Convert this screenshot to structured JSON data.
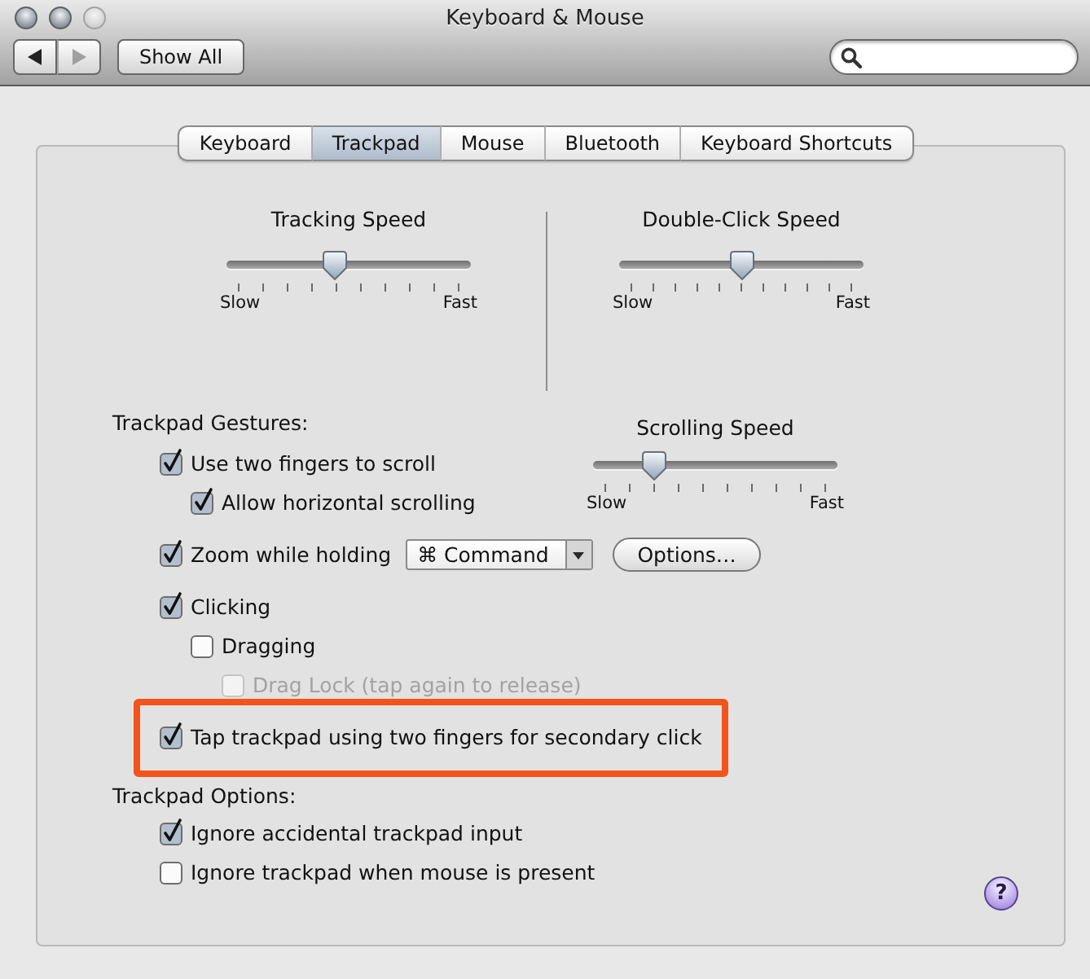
{
  "window": {
    "title": "Keyboard & Mouse",
    "buttons": [
      {
        "disabled": false
      },
      {
        "disabled": false
      },
      {
        "disabled": true
      }
    ]
  },
  "toolbar": {
    "back": {
      "disabled": false
    },
    "forward": {
      "disabled": true
    },
    "show_all": "Show All"
  },
  "tabs": [
    {
      "label": "Keyboard",
      "selected": false
    },
    {
      "label": "Trackpad",
      "selected": true
    },
    {
      "label": "Mouse",
      "selected": false
    },
    {
      "label": "Bluetooth",
      "selected": false
    },
    {
      "label": "Keyboard Shortcuts",
      "selected": false
    }
  ],
  "speed_sliders": [
    {
      "title": "Tracking Speed",
      "level": 0.44,
      "min_label": "Slow",
      "max_label": "Fast"
    },
    {
      "title": "Double-Click Speed",
      "level": 0.5,
      "min_label": "Slow",
      "max_label": "Fast"
    }
  ],
  "gestures": {
    "heading": "Trackpad Gestures:",
    "scrolling_speed": {
      "title": "Scrolling Speed",
      "level": 0.22,
      "min_label": "Slow",
      "max_label": "Fast"
    },
    "items": [
      {
        "kind": "checkbox",
        "label": "Use two fingers to scroll",
        "checked": true,
        "disabled": false,
        "highlighted": false,
        "children": [
          {
            "kind": "checkbox",
            "label": "Allow horizontal scrolling",
            "checked": true,
            "disabled": false
          }
        ]
      },
      {
        "kind": "checkbox_popup",
        "label": "Zoom while holding",
        "checked": true,
        "disabled": false,
        "highlighted": false,
        "popup": "⌘ Command",
        "button": "Options…"
      },
      {
        "kind": "checkbox",
        "label": "Clicking",
        "checked": true,
        "disabled": false,
        "highlighted": false,
        "children": [
          {
            "kind": "checkbox",
            "label": "Dragging",
            "checked": false,
            "disabled": false,
            "children": [
              {
                "kind": "checkbox",
                "label": "Drag Lock (tap again to release)",
                "checked": false,
                "disabled": true
              }
            ]
          }
        ]
      },
      {
        "kind": "checkbox",
        "label": "Tap trackpad using two fingers for secondary click",
        "checked": true,
        "disabled": false,
        "highlighted": true
      }
    ]
  },
  "options": {
    "heading": "Trackpad Options:",
    "items": [
      {
        "label": "Ignore accidental trackpad input",
        "checked": true
      },
      {
        "label": "Ignore trackpad when mouse is present",
        "checked": false
      }
    ]
  },
  "help_button": {
    "label": "?"
  }
}
